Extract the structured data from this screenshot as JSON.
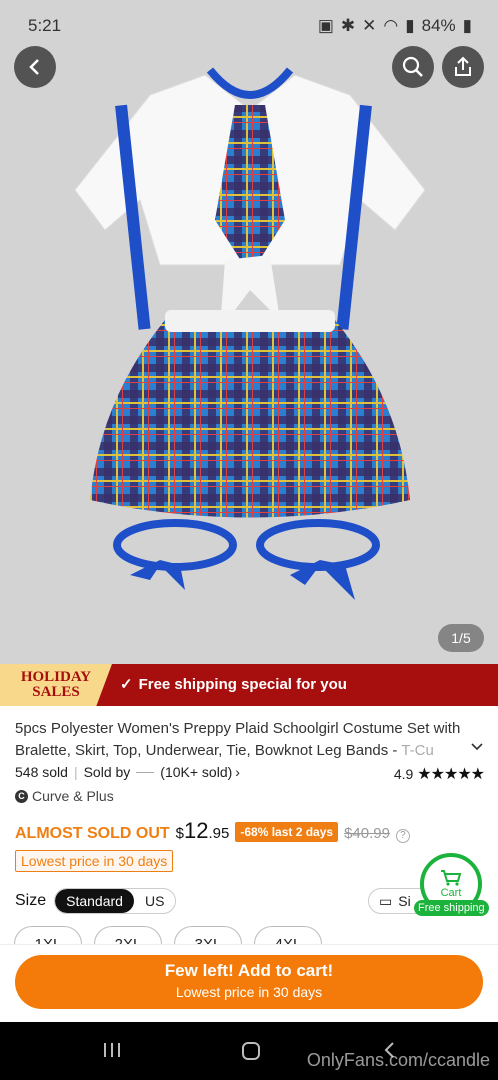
{
  "status_bar": {
    "time": "5:21",
    "battery": "84%"
  },
  "gallery": {
    "counter": "1/5"
  },
  "banner": {
    "holiday_line1": "HOLIDAY",
    "holiday_line2": "SALES",
    "message": "Free shipping special for you"
  },
  "product": {
    "title": "5pcs Polyester Women's Preppy Plaid Schoolgirl Costume Set with Bralette, Skirt, Top, Underwear, Tie, Bowknot Leg Bands - T-Cu",
    "title_main": "5pcs Polyester Women's Preppy Plaid Schoolgirl Costume Set with Bralette, Skirt, Top, Underwear, Tie, Bowknot Leg Bands -",
    "title_fade": "T-Cu",
    "sold": "548 sold",
    "sold_by_label": "Sold by",
    "seller_sold": "(10K+ sold)",
    "rating": "4.9",
    "stars": "★★★★★",
    "brand": "Curve & Plus",
    "brand_icon": "C"
  },
  "pricing": {
    "urgency": "ALMOST SOLD OUT",
    "currency": "$",
    "price_whole": "12",
    "price_cents": ".95",
    "discount": "-68% last 2 days",
    "original": "$40.99",
    "lowest_tag": "Lowest price in 30 days"
  },
  "size": {
    "label": "Size",
    "standard": "Standard",
    "us": "US",
    "guide": "Si",
    "options": [
      "1XL",
      "2XL",
      "3XL",
      "4XL"
    ]
  },
  "cart_fab": {
    "label": "Cart",
    "badge": "Free shipping"
  },
  "cta": {
    "title": "Few left! Add to cart!",
    "subtitle": "Lowest price in 30 days"
  },
  "watermark": "OnlyFans.com/ccandle",
  "colors": {
    "accent": "#f47b09",
    "banner": "#a70f0f",
    "green": "#1bb33b"
  }
}
